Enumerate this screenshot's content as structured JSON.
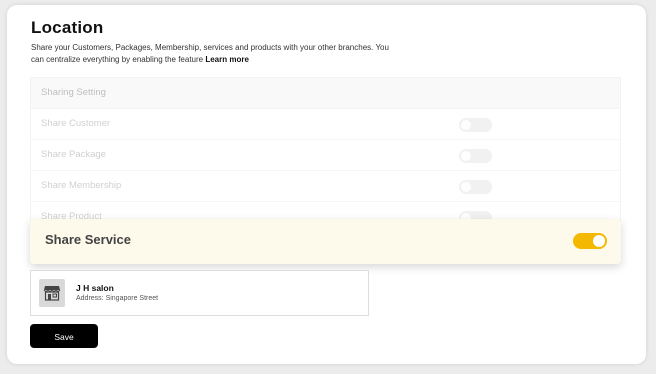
{
  "page": {
    "title": "Location",
    "description": "Share your Customers, Packages, Membership, services and products with your other branches. You can centralize everything by enabling the feature",
    "learn_more": "Learn more"
  },
  "sharing": {
    "header": "Sharing Setting",
    "rows": [
      {
        "label": "Share Customer",
        "enabled": false
      },
      {
        "label": "Share Package",
        "enabled": false
      },
      {
        "label": "Share Membership",
        "enabled": false
      },
      {
        "label": "Share Product",
        "enabled": false
      }
    ],
    "highlighted": {
      "label": "Share Service",
      "enabled": true
    }
  },
  "branch": {
    "name": "J H salon",
    "address": "Address: Singapore Street",
    "icon": "store-icon"
  },
  "actions": {
    "save_label": "Save"
  },
  "colors": {
    "accent": "#f5b800",
    "highlight_bg": "#fefaeb",
    "button_bg": "#000000"
  }
}
